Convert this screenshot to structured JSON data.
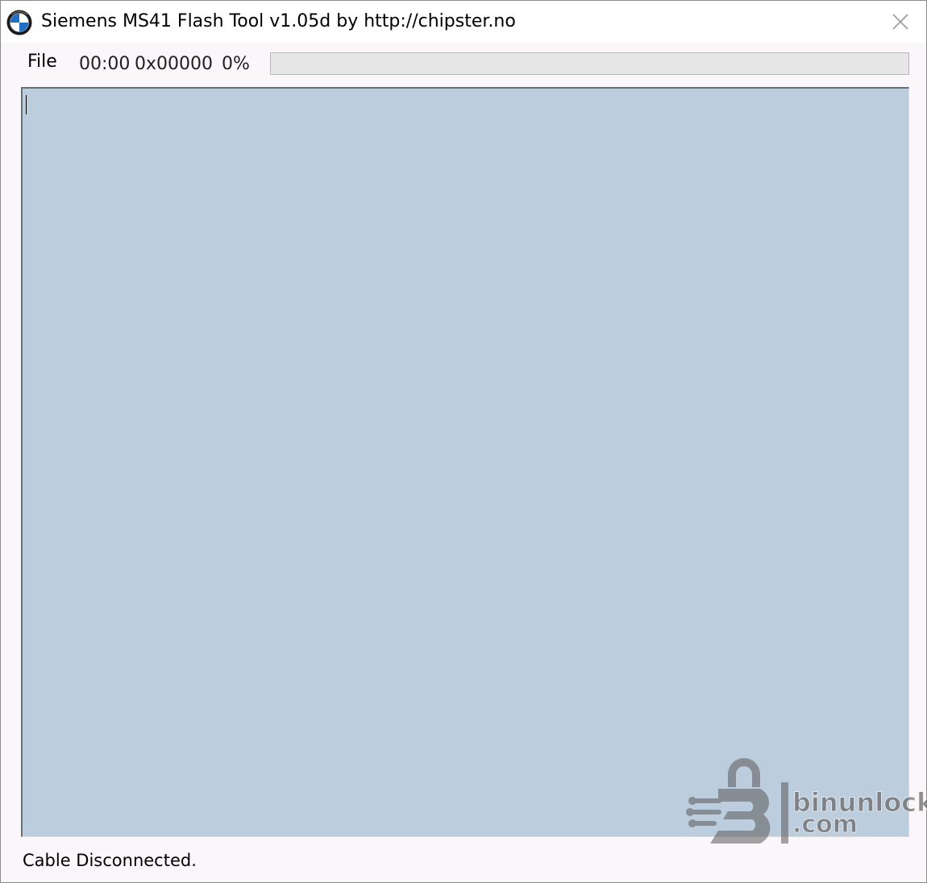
{
  "window": {
    "title": "Siemens MS41 Flash Tool v1.05d by http://chipster.no",
    "app_icon": "bmw-roundel-icon",
    "close_icon": "close-icon"
  },
  "menubar": {
    "file_label": "File",
    "elapsed_time": "00:00",
    "address": "0x00000",
    "percent": "0%"
  },
  "progress": {
    "value": 0
  },
  "log": {
    "text": ""
  },
  "status_bar": {
    "text": "Cable Disconnected."
  },
  "watermark": {
    "line1": "binunlock",
    "line2": ".com"
  },
  "colors": {
    "log_background": "#bccddd",
    "window_background": "#fbf6f9",
    "progress_track": "#e6e6e6"
  }
}
